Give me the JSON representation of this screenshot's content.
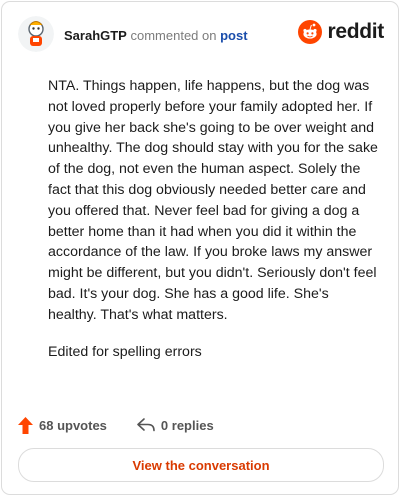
{
  "header": {
    "username": "SarahGTP",
    "verb": "commented on",
    "post_link": "post",
    "brand": "reddit"
  },
  "comment": {
    "paragraphs": [
      "NTA. Things happen, life happens, but the dog was not loved properly before your family adopted her. If you give her back she's going to be over weight and unhealthy. The dog should stay with you for the sake of the dog, not even the human aspect. Solely the fact that this dog obviously needed better care and you offered that. Never feel bad for giving a dog a better home than it had when you did it within the accordance of the law. If you broke laws my answer might be different, but you didn't. Seriously don't feel bad. It's your dog. She has a good life. She's healthy. That's what matters.",
      "Edited for spelling errors"
    ]
  },
  "footer": {
    "upvotes": "68 upvotes",
    "replies": "0 replies",
    "cta": "View the conversation"
  },
  "colors": {
    "brand_orange": "#ff4500",
    "upvote": "#ff4500",
    "link_blue": "#1a4dab",
    "cta_text": "#d93a00"
  },
  "icons": [
    "avatar",
    "reddit-logo-icon",
    "upvote-icon",
    "reply-icon"
  ]
}
